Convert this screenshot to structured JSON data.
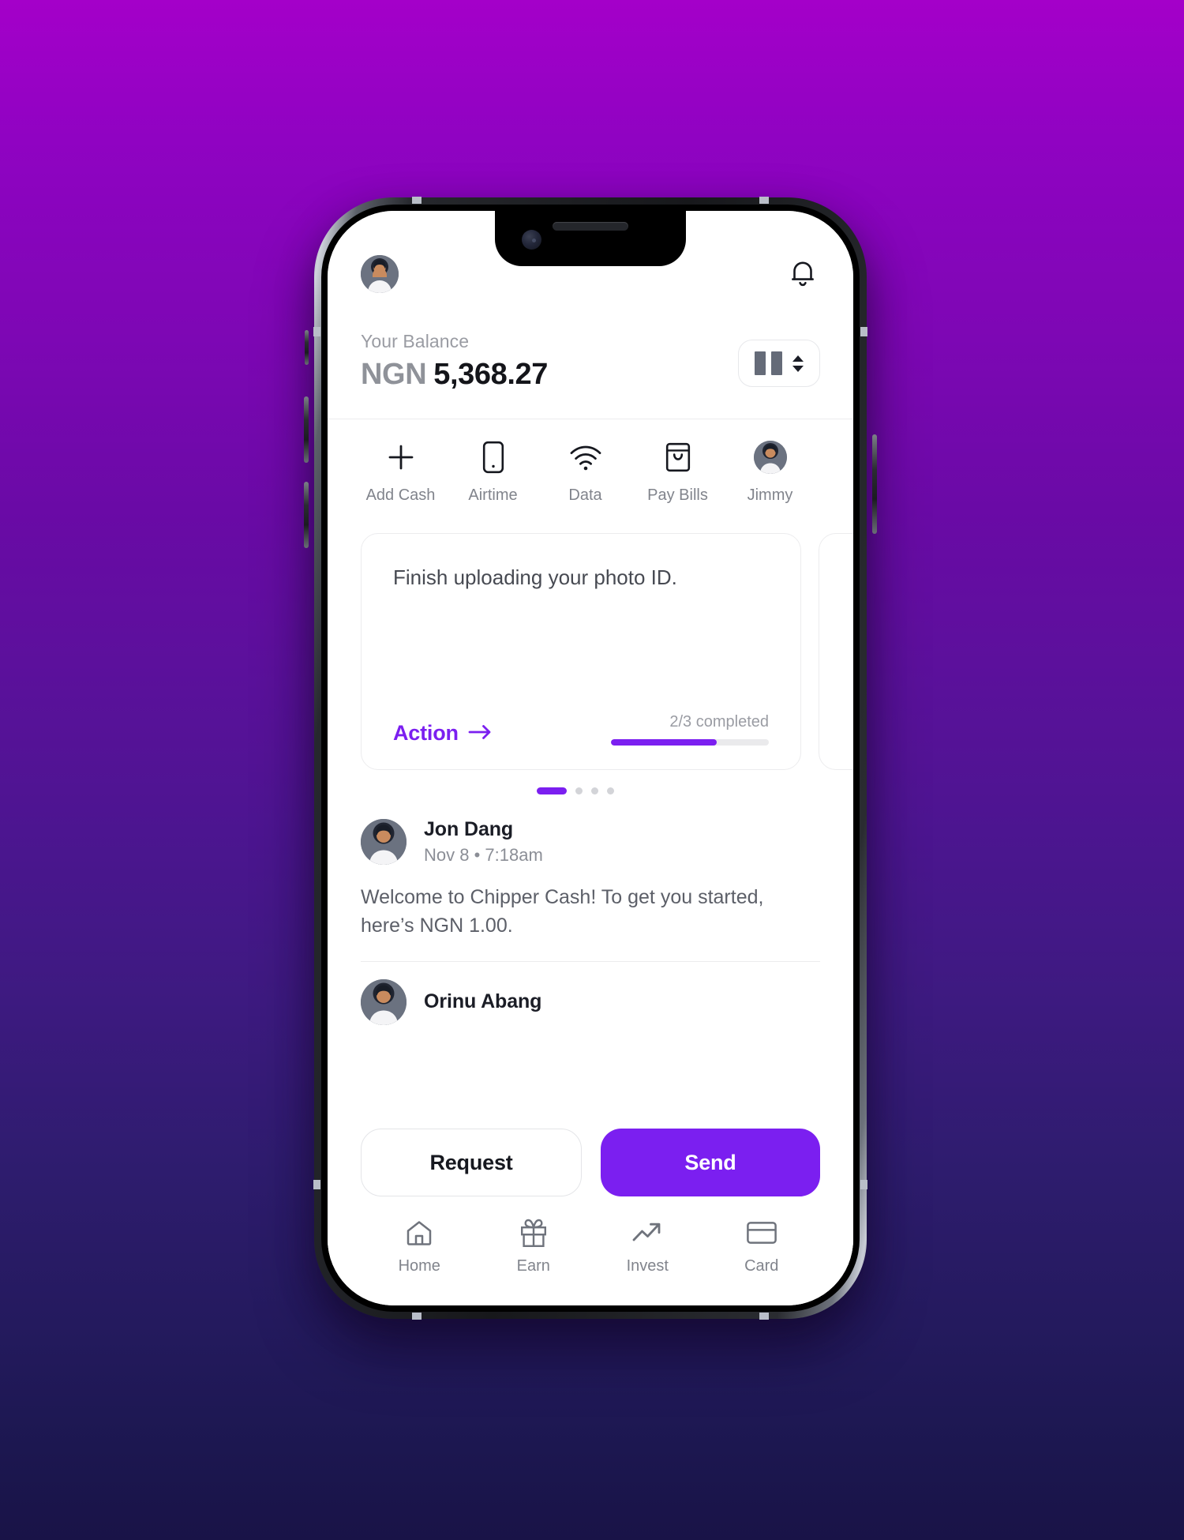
{
  "background": {
    "gradient_top": "#a400c9",
    "gradient_bottom": "#191347"
  },
  "theme": {
    "accent": "#7b1ff0",
    "text_dark": "#1b1d26",
    "text_muted": "#8b8e96"
  },
  "header": {
    "avatar_icon": "user-avatar",
    "notification_icon": "bell-icon"
  },
  "balance": {
    "label": "Your Balance",
    "currency": "NGN",
    "amount": "5,368.27",
    "selector": {
      "flag_icon": "flag-placeholder",
      "stepper_icon": "up-down-chevron"
    }
  },
  "quick_actions": [
    {
      "label": "Add Cash",
      "icon": "plus-icon"
    },
    {
      "label": "Airtime",
      "icon": "phone-icon"
    },
    {
      "label": "Data",
      "icon": "wifi-icon"
    },
    {
      "label": "Pay Bills",
      "icon": "shopping-bag-icon"
    },
    {
      "label": "Jimmy",
      "icon": "contact-avatar"
    }
  ],
  "cards": [
    {
      "title": "Finish uploading your photo ID.",
      "action_label": "Action",
      "action_icon": "arrow-right-icon",
      "progress_label": "2/3 completed",
      "progress_percent": 67
    },
    {
      "title": "",
      "action_label": "",
      "action_icon": "arrow-right-icon",
      "progress_label": "",
      "progress_percent": 0
    }
  ],
  "pagination": {
    "total": 4,
    "active_index": 0
  },
  "feed": [
    {
      "name": "Jon Dang",
      "meta": "Nov 8 • 7:18am",
      "body": "Welcome to Chipper Cash! To get you started, here’s NGN 1.00.",
      "avatar_icon": "user-avatar"
    },
    {
      "name": "Orinu Abang",
      "meta": "",
      "body": "",
      "avatar_icon": "user-avatar"
    }
  ],
  "bottom_actions": {
    "request_label": "Request",
    "send_label": "Send"
  },
  "tabbar": [
    {
      "label": "Home",
      "icon": "home-icon"
    },
    {
      "label": "Earn",
      "icon": "gift-icon"
    },
    {
      "label": "Invest",
      "icon": "trending-up-icon"
    },
    {
      "label": "Card",
      "icon": "credit-card-icon"
    }
  ]
}
